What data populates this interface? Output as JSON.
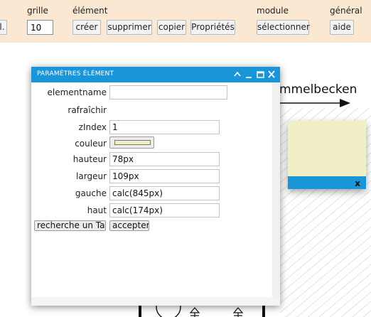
{
  "toolbar": {
    "truncated_button_label": "l.",
    "sections": {
      "grille": "grille",
      "element": "élément",
      "module": "module",
      "general": "général"
    },
    "grid_value": "10",
    "buttons": {
      "create": "créer",
      "delete": "supprimer",
      "copy": "copier",
      "properties": "Propriétés",
      "select": "sélectionner",
      "help": "aide"
    }
  },
  "canvas": {
    "connector_label": "mmelbecken",
    "popup_close": "x"
  },
  "dialog": {
    "title": "PARAMÈTRES ÉLÉMENT",
    "fields": {
      "elementname": {
        "label": "elementname",
        "value": ""
      },
      "refresh": {
        "label": "rafraîchir",
        "checked": false
      },
      "zindex": {
        "label": "zIndex",
        "value": "1"
      },
      "color": {
        "label": "couleur",
        "value": "#f0efc6"
      },
      "height": {
        "label": "hauteur",
        "value": "78px"
      },
      "width": {
        "label": "largeur",
        "value": "109px"
      },
      "left": {
        "label": "gauche",
        "value": "calc(845px)"
      },
      "top": {
        "label": "haut",
        "value": "calc(174px)"
      }
    },
    "buttons": {
      "search_tag": "recherche un Tag",
      "accept": "accepter"
    }
  },
  "colors": {
    "toolbar_bg": "#fbe8d2",
    "accent": "#1a96d8",
    "popup_bg": "#f0efc6"
  }
}
